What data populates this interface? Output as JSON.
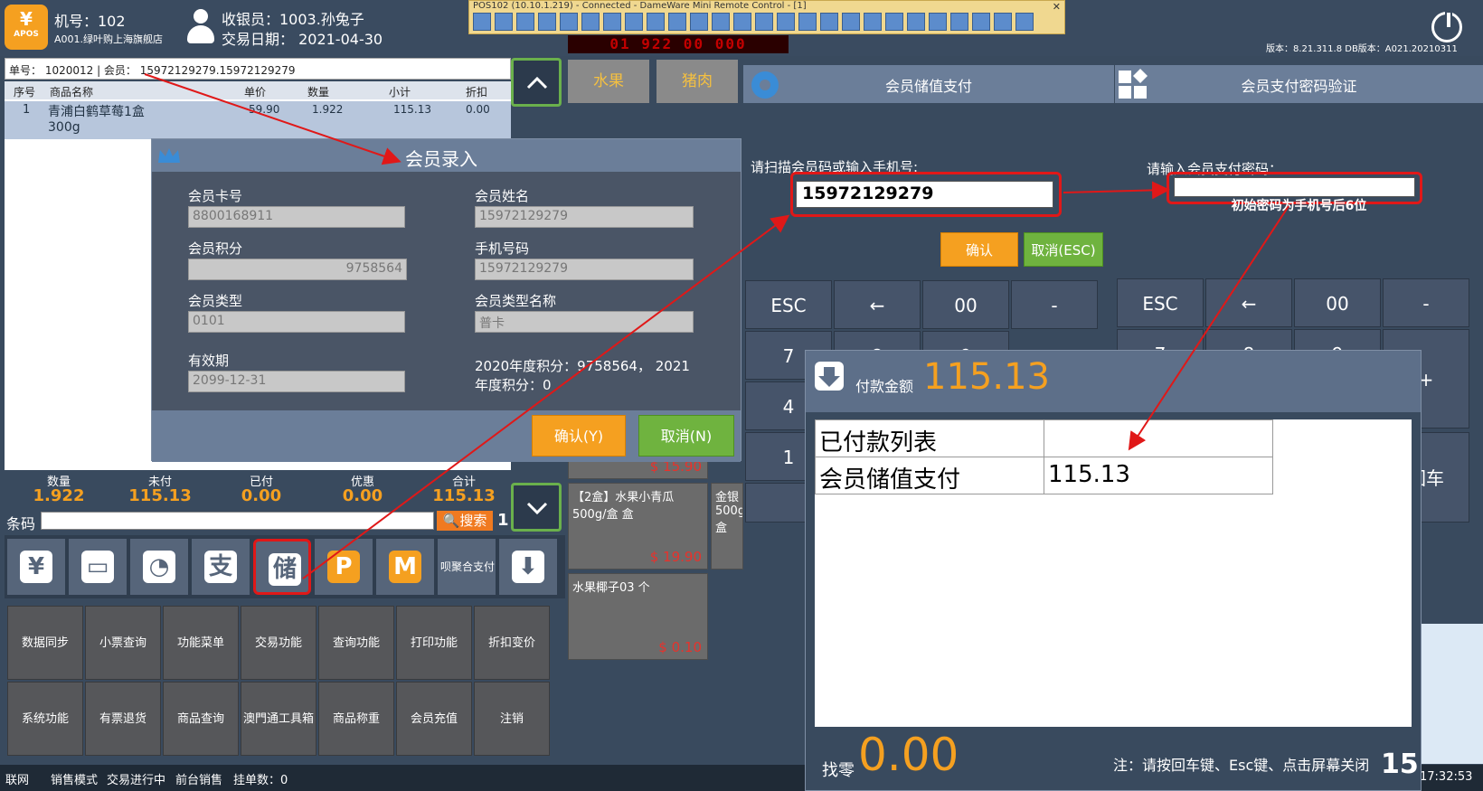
{
  "header": {
    "logo_symbol": "¥",
    "logo_text": "APOS",
    "machine_no": "机号：102",
    "store": "A001.绿叶购上海旗舰店",
    "cashier": "收银员：1003.孙兔子",
    "trade_date": "交易日期：  2021-04-30",
    "version": "版本：8.21.311.8 DB版本：A021.20210311"
  },
  "remote": {
    "title": "POS102 (10.10.1.219) - Connected - DameWare Mini Remote Control - [1]",
    "led": "01 922 00 000"
  },
  "order": {
    "info": "单号：  1020012   | 会员：   15972129279.15972129279",
    "columns": [
      "序号",
      "商品名称",
      "单价",
      "数量",
      "小计",
      "折扣"
    ],
    "row": {
      "no": "1",
      "name1": "青浦白鹤草莓1盒",
      "name2": "300g",
      "price": "59.90",
      "qty": "1.922",
      "subtotal": "115.13",
      "discount": "0.00"
    }
  },
  "totals": {
    "labels": [
      "数量",
      "未付",
      "已付",
      "优惠",
      "合计"
    ],
    "values": [
      "1.922",
      "115.13",
      "0.00",
      "0.00",
      "115.13"
    ]
  },
  "barcode": {
    "label": "条码",
    "search": "搜索",
    "count": "1"
  },
  "pay_buttons": [
    "¥",
    "▭",
    "◔",
    "支",
    "储",
    "P",
    "M",
    "呗聚合支付",
    "⬇"
  ],
  "functions": [
    "数据同步",
    "小票查询",
    "功能菜单",
    "交易功能",
    "查询功能",
    "打印功能",
    "折扣变价",
    "系统功能",
    "有票退货",
    "商品查询",
    "澳門通工具箱",
    "商品称重",
    "会员充值",
    "注销"
  ],
  "categories": [
    "水果",
    "猪肉"
  ],
  "tiles": [
    {
      "name": "",
      "price": "$ 15.90"
    },
    {
      "name": "【2盒】水果小青瓜 500g/盒 盒",
      "price": "$ 19.90"
    },
    {
      "name": "金银 500g 盒",
      "price": ""
    },
    {
      "name": "水果椰子03 个",
      "price": "$ 0.10"
    }
  ],
  "member_dialog": {
    "title": "会员录入",
    "card_no_label": "会员卡号",
    "card_no": "8800168911",
    "name_label": "会员姓名",
    "name": "15972129279",
    "points_label": "会员积分",
    "points": "9758564",
    "phone_label": "手机号码",
    "phone": "15972129279",
    "type_label": "会员类型",
    "type": "0101",
    "type_name_label": "会员类型名称",
    "type_name": "普卡",
    "expiry_label": "有效期",
    "expiry": "2099-12-31",
    "yearly_points": "2020年度积分：9758564， 2021年度积分：0",
    "confirm": "确认(Y)",
    "cancel": "取消(N)"
  },
  "stored_pay": {
    "title": "会员储值支付",
    "prompt": "请扫描会员码或输入手机号:",
    "value": "15972129279",
    "confirm": "确认",
    "cancel": "取消(ESC)",
    "keys": [
      "ESC",
      "←",
      "00",
      "-",
      "7",
      "8",
      "9",
      "4",
      "1"
    ]
  },
  "pwd_verify": {
    "title": "会员支付密码验证",
    "prompt": "请输入会员支付密码：",
    "hint": "初始密码为手机号后6位",
    "keys": [
      "ESC",
      "←",
      "00",
      "-",
      "7",
      "8",
      "9",
      "+",
      "回车"
    ]
  },
  "payment": {
    "amount_label": "付款金额",
    "amount": "115.13",
    "paid_list": "已付款列表",
    "method": "会员储值支付",
    "method_amount": "115.13",
    "change_label": "找零",
    "change": "0.00",
    "note": "注：请按回车键、Esc键、点击屏幕关闭",
    "countdown": "15"
  },
  "status": {
    "items": [
      "联网",
      "销售模式",
      "交易进行中",
      "前台销售",
      "挂单数：0"
    ],
    "time": "17:32:53"
  },
  "colors": {
    "accent": "#f5a020",
    "highlight": "#e01818",
    "ok": "#6fb33f"
  }
}
